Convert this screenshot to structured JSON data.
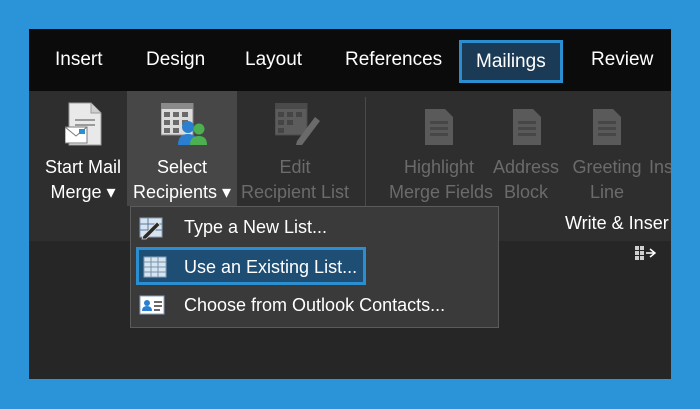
{
  "tabs": [
    {
      "label": "Insert"
    },
    {
      "label": "Design"
    },
    {
      "label": "Layout"
    },
    {
      "label": "References"
    },
    {
      "label": "Mailings",
      "active": true
    },
    {
      "label": "Review"
    }
  ],
  "ribbon": {
    "start_mail_merge": {
      "line1": "Start Mail",
      "line2": "Merge ▾"
    },
    "select_recipients": {
      "line1": "Select",
      "line2": "Recipients ▾"
    },
    "edit_recipient_list": {
      "line1": "Edit",
      "line2": "Recipient List"
    },
    "highlight_merge_fields": {
      "line1": "Highlight",
      "line2": "Merge Fields"
    },
    "address_block": {
      "line1": "Address",
      "line2": "Block"
    },
    "greeting_line": {
      "line1": "Greeting",
      "line2": "Line"
    },
    "insert_partial": {
      "line1": "Ins"
    },
    "write_insert_group": "Write & Inser"
  },
  "menu": {
    "items": [
      {
        "label": "Type a New List...",
        "icon": "new-list-icon"
      },
      {
        "label": "Use an Existing List...",
        "icon": "existing-list-icon",
        "highlighted": true
      },
      {
        "label": "Choose from Outlook Contacts...",
        "icon": "contacts-icon"
      }
    ]
  },
  "colors": {
    "accent": "#2a8ed1",
    "background": "#2b93d7",
    "tabbar": "#0b0b0b",
    "ribbon": "#2e2e2e",
    "menu": "#3a3a3a"
  }
}
